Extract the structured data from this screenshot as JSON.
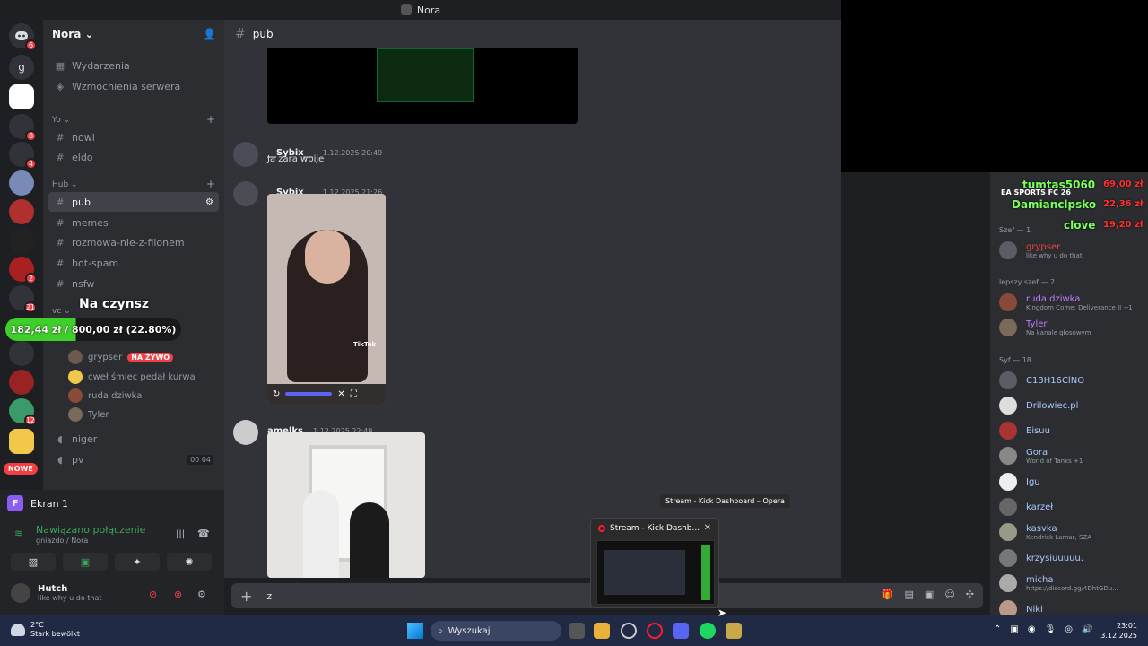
{
  "window": {
    "title": "Nora"
  },
  "server": {
    "name": "Nora"
  },
  "rail": {
    "items": [
      {
        "label": "",
        "badge": "6",
        "color": "#313338"
      },
      {
        "label": "g",
        "badge": "",
        "color": "#313338"
      },
      {
        "label": "",
        "badge": "",
        "color": "#ffffff"
      },
      {
        "label": "",
        "badge": "8",
        "color": "#313338"
      },
      {
        "label": "",
        "badge": "4",
        "color": "#313338"
      },
      {
        "label": "",
        "badge": "",
        "color": "#7a8ab8"
      },
      {
        "label": "",
        "badge": "",
        "color": "#b03030"
      },
      {
        "label": "",
        "badge": "",
        "color": "#222222"
      },
      {
        "label": "",
        "badge": "2",
        "color": "#a82020"
      },
      {
        "label": "",
        "badge": "21",
        "color": "#313338"
      },
      {
        "label": "",
        "badge": "",
        "color": "#313338"
      },
      {
        "label": "",
        "badge": "",
        "color": "#992222"
      },
      {
        "label": "",
        "badge": "12",
        "color": "#3a9a6a"
      },
      {
        "label": "",
        "badge": "",
        "color": "#f2c84b"
      }
    ],
    "nowe": "NOWE"
  },
  "sidebar": {
    "top_items": [
      {
        "label": "Wydarzenia",
        "icon": "calendar-icon"
      },
      {
        "label": "Wzmocnienia serwera",
        "icon": "boost-icon"
      }
    ],
    "categories": [
      {
        "label": "Yo"
      },
      {
        "label": "Hub"
      },
      {
        "label": "vc"
      }
    ],
    "channels_yo": [
      "nowi",
      "eldo"
    ],
    "channels_hub": [
      "pub",
      "memes",
      "rozmowa-nie-z-filonem",
      "bot-spam",
      "nsfw"
    ],
    "active_channel": "pub",
    "voice_users": [
      {
        "name": "grypser",
        "live": "NA ŻYWO"
      },
      {
        "name": "cweł śmiec pedał kurwa",
        "live": ""
      },
      {
        "name": "ruda dziwka",
        "live": ""
      },
      {
        "name": "Tyler",
        "live": ""
      }
    ],
    "voice_channels": [
      {
        "label": "niger"
      },
      {
        "label": "pv",
        "count_a": "00",
        "count_b": "04"
      }
    ]
  },
  "overlay": {
    "title": "Na czynsz",
    "progress_text": "182,44 zł / 800,00 zł (22.80%)",
    "progress_fraction": 0.228
  },
  "userpanel": {
    "ekran_label": "Ekran 1",
    "connection": "Nawiązano połączenie",
    "connection_sub": "gniazdo / Nora",
    "user_name": "Hutch",
    "user_status": "like why u do that"
  },
  "chat": {
    "channel": "pub",
    "messages": [
      {
        "user": "__Sybix__",
        "time": "1.12.2025 20:49",
        "text": "Ja zara wbije"
      },
      {
        "user": "__Sybix__",
        "time": "1.12.2025 21:26",
        "text": ""
      },
      {
        "user": "amelks",
        "time": "1.12.2025 22:49",
        "text": ""
      }
    ],
    "tiktok_label": "TikTok",
    "input_value": "z"
  },
  "taskbar_preview": {
    "tooltip": "Stream - Kick Dashboard – Opera",
    "title": "Stream - Kick Dashb..."
  },
  "members": {
    "donations": [
      {
        "name": "tumtas5060",
        "amount": "69,00 zł"
      },
      {
        "name": "Damianclpsko",
        "amount": "22,36 zł"
      },
      {
        "name": "clove",
        "amount": "19,20 zł"
      }
    ],
    "game_label": "EA SPORTS FC 26",
    "groups": [
      {
        "label": "Szef — 1",
        "users": [
          {
            "name": "grypser",
            "status": "like why u do that",
            "color": "#f23f43"
          }
        ]
      },
      {
        "label": "lepszy szef — 2",
        "users": [
          {
            "name": "ruda dziwka",
            "status": "Kingdom Come: Deliverance II +1",
            "color": "#c27cff"
          },
          {
            "name": "Tyler",
            "status": "Na kanale głosowym",
            "color": "#c27cff"
          }
        ]
      },
      {
        "label": "Syf — 18",
        "users": [
          {
            "name": "C13H16ClNO",
            "status": "",
            "color": "#a9c9ff"
          },
          {
            "name": "Drilowiec.pl",
            "status": "",
            "color": "#a9c9ff"
          },
          {
            "name": "Eisuu",
            "status": "",
            "color": "#a9c9ff"
          },
          {
            "name": "Gora",
            "status": "World of Tanks +1",
            "color": "#a9c9ff"
          },
          {
            "name": "Igu",
            "status": "",
            "color": "#a9c9ff"
          },
          {
            "name": "karzeł",
            "status": "",
            "color": "#a9c9ff"
          },
          {
            "name": "kasvka",
            "status": "Kendrick Lamar, SZA",
            "color": "#a9c9ff"
          },
          {
            "name": "krzysiuuuuu.",
            "status": "",
            "color": "#a9c9ff"
          },
          {
            "name": "micha",
            "status": "https://discord.gg/4DhtGDu...",
            "color": "#a9c9ff"
          },
          {
            "name": "Niki",
            "status": "",
            "color": "#a9c9ff"
          }
        ]
      }
    ]
  },
  "taskbar": {
    "weather_temp": "2°C",
    "weather_desc": "Stark bewölkt",
    "search_placeholder": "Wyszukaj",
    "time": "23:01",
    "date": "3.12.2025"
  }
}
